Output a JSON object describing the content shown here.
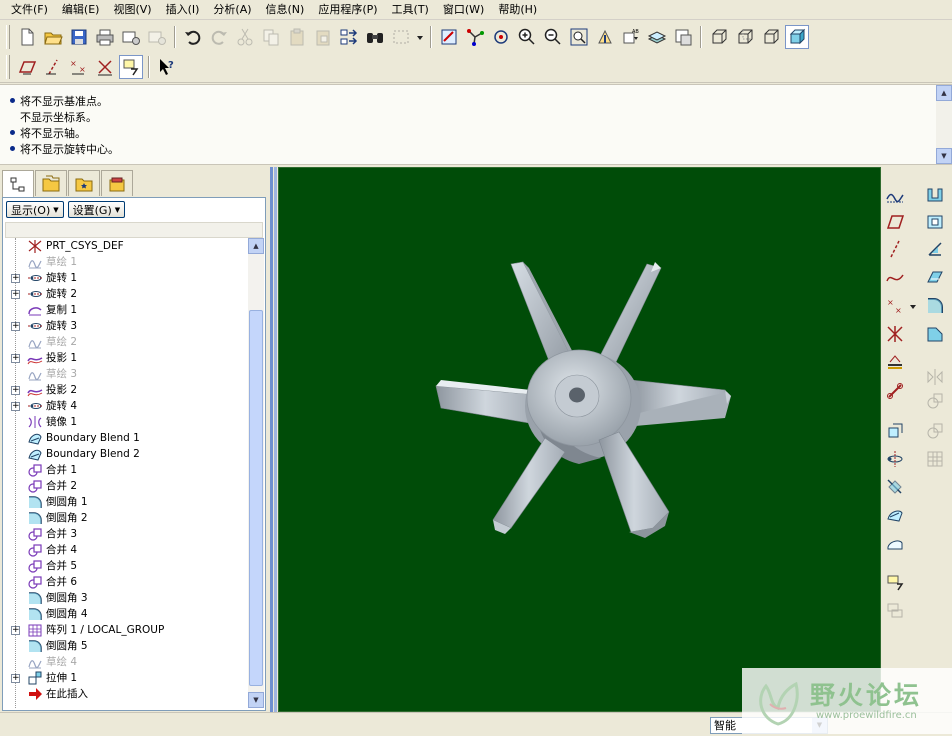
{
  "menubar": {
    "items": [
      "文件(F)",
      "编辑(E)",
      "视图(V)",
      "插入(I)",
      "分析(A)",
      "信息(N)",
      "应用程序(P)",
      "工具(T)",
      "窗口(W)",
      "帮助(H)"
    ]
  },
  "messages": [
    {
      "text": "将不显示基准点。",
      "bullet": true
    },
    {
      "text": "不显示坐标系。",
      "bullet": false
    },
    {
      "text": "将不显示轴。",
      "bullet": true
    },
    {
      "text": "将不显示旋转中心。",
      "bullet": true
    }
  ],
  "left_panel": {
    "show_button": "显示(O)",
    "settings_button": "设置(G)"
  },
  "model_tree": [
    {
      "label": "PRT_CSYS_DEF",
      "icon": "csys-icon",
      "expander": false,
      "dim": false
    },
    {
      "label": "草绘 1",
      "icon": "sketch-icon",
      "expander": false,
      "dim": true
    },
    {
      "label": "旋转 1",
      "icon": "revolve-icon",
      "expander": true,
      "dim": false
    },
    {
      "label": "旋转 2",
      "icon": "revolve-icon",
      "expander": true,
      "dim": false
    },
    {
      "label": "复制 1",
      "icon": "copy-icon",
      "expander": false,
      "dim": false
    },
    {
      "label": "旋转 3",
      "icon": "revolve-icon",
      "expander": true,
      "dim": false
    },
    {
      "label": "草绘 2",
      "icon": "sketch-icon",
      "expander": false,
      "dim": true
    },
    {
      "label": "投影 1",
      "icon": "project-icon",
      "expander": true,
      "dim": false
    },
    {
      "label": "草绘 3",
      "icon": "sketch-icon",
      "expander": false,
      "dim": true
    },
    {
      "label": "投影 2",
      "icon": "project-icon",
      "expander": true,
      "dim": false
    },
    {
      "label": "旋转 4",
      "icon": "revolve-icon",
      "expander": true,
      "dim": false
    },
    {
      "label": "镜像 1",
      "icon": "mirror-icon",
      "expander": false,
      "dim": false
    },
    {
      "label": "Boundary Blend 1",
      "icon": "boundary-blend-icon",
      "expander": false,
      "dim": false
    },
    {
      "label": "Boundary Blend 2",
      "icon": "boundary-blend-icon",
      "expander": false,
      "dim": false
    },
    {
      "label": "合并 1",
      "icon": "merge-icon",
      "expander": false,
      "dim": false
    },
    {
      "label": "合并 2",
      "icon": "merge-icon",
      "expander": false,
      "dim": false
    },
    {
      "label": "倒圆角 1",
      "icon": "round-icon",
      "expander": false,
      "dim": false
    },
    {
      "label": "倒圆角 2",
      "icon": "round-icon",
      "expander": false,
      "dim": false
    },
    {
      "label": "合并 3",
      "icon": "merge-icon",
      "expander": false,
      "dim": false
    },
    {
      "label": "合并 4",
      "icon": "merge-icon",
      "expander": false,
      "dim": false
    },
    {
      "label": "合并 5",
      "icon": "merge-icon",
      "expander": false,
      "dim": false
    },
    {
      "label": "合并 6",
      "icon": "merge-icon",
      "expander": false,
      "dim": false
    },
    {
      "label": "倒圆角 3",
      "icon": "round-icon",
      "expander": false,
      "dim": false
    },
    {
      "label": "倒圆角 4",
      "icon": "round-icon",
      "expander": false,
      "dim": false
    },
    {
      "label": "阵列 1 / LOCAL_GROUP",
      "icon": "pattern-icon",
      "expander": true,
      "dim": false
    },
    {
      "label": "倒圆角 5",
      "icon": "round-icon",
      "expander": false,
      "dim": false
    },
    {
      "label": "草绘 4",
      "icon": "sketch-icon",
      "expander": false,
      "dim": true
    },
    {
      "label": "拉伸 1",
      "icon": "extrude-icon",
      "expander": true,
      "dim": false
    },
    {
      "label": "在此插入",
      "icon": "insert-here-arrow-icon",
      "expander": false,
      "dim": false
    }
  ],
  "status": {
    "filter_value": "智能"
  },
  "watermark": {
    "text": "野火论坛",
    "url": "www.proewildfire.cn"
  },
  "colors": {
    "viewport_background": "#004c08",
    "model_surface": "#b4bcc4",
    "accent_blue": "#0a2a8a"
  }
}
